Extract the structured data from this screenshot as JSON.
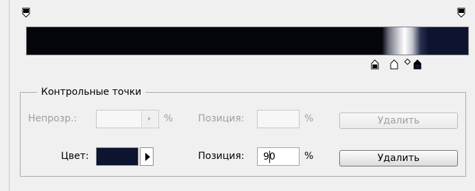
{
  "colors": {
    "selected_color": "#0d1430",
    "gradient_dark": "#05060c"
  },
  "icons": {
    "opacity_stop": "opacity-stop-icon",
    "color_stop": "color-stop-icon",
    "midpoint": "midpoint-diamond-icon",
    "spin_arrow": "spin-arrow-icon",
    "swatch_arrow": "play-arrow-icon"
  },
  "stops": {
    "group_title": "Контрольные точки",
    "opacity_row": {
      "label": "Непрозр.:",
      "value": "",
      "unit": "%",
      "position_label": "Позиция:",
      "position_value": "",
      "position_unit": "%",
      "delete_label": "Удалить"
    },
    "color_row": {
      "label": "Цвет:",
      "position_label": "Позиция:",
      "position_value": "90",
      "position_unit": "%",
      "delete_label": "Удалить"
    }
  }
}
